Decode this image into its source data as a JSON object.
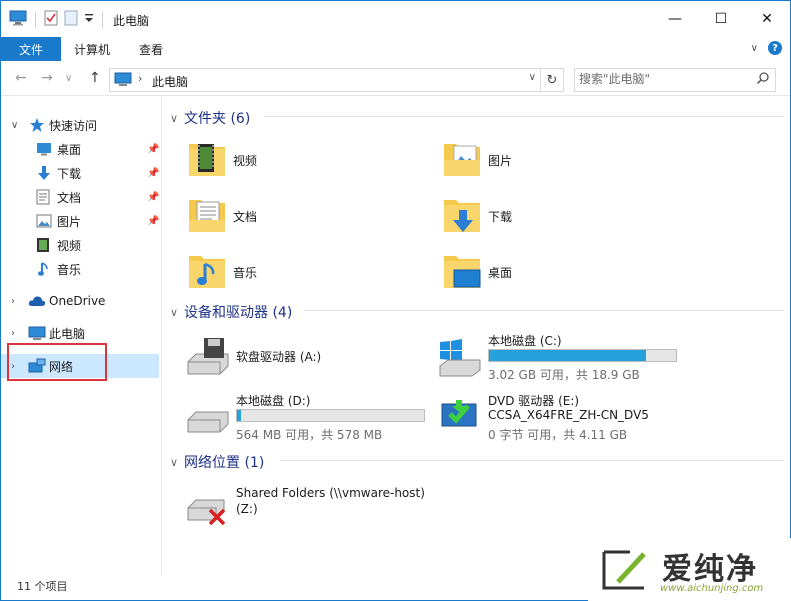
{
  "window": {
    "title": "此电脑",
    "minimize_glyph": "—",
    "maximize_glyph": "☐",
    "close_glyph": "✕"
  },
  "ribbon": {
    "file_tab": "文件",
    "tabs": [
      "计算机",
      "查看"
    ],
    "expand_glyph": "∨",
    "help_glyph": "?"
  },
  "address": {
    "crumb": "此电脑",
    "back_glyph": "←",
    "forward_glyph": "→",
    "up_glyph": "↑",
    "recent_glyph": "∨",
    "refresh_glyph": "↻",
    "search_placeholder": "搜索\"此电脑\""
  },
  "nav": {
    "quick_access": "快速访问",
    "quick_items": [
      {
        "label": "桌面",
        "icon": "desktop-icon",
        "pinned": true
      },
      {
        "label": "下载",
        "icon": "download-icon",
        "pinned": true
      },
      {
        "label": "文档",
        "icon": "document-icon",
        "pinned": true
      },
      {
        "label": "图片",
        "icon": "picture-icon",
        "pinned": true
      },
      {
        "label": "视频",
        "icon": "video-icon",
        "pinned": false
      },
      {
        "label": "音乐",
        "icon": "music-icon",
        "pinned": false
      }
    ],
    "onedrive": "OneDrive",
    "this_pc": "此电脑",
    "network": "网络"
  },
  "content": {
    "folders_header": "文件夹 (6)",
    "folders": [
      {
        "label": "视频",
        "icon": "video-folder-icon"
      },
      {
        "label": "图片",
        "icon": "picture-folder-icon"
      },
      {
        "label": "文档",
        "icon": "document-folder-icon"
      },
      {
        "label": "下载",
        "icon": "download-folder-icon"
      },
      {
        "label": "音乐",
        "icon": "music-folder-icon"
      },
      {
        "label": "桌面",
        "icon": "desktop-folder-icon"
      }
    ],
    "devices_header": "设备和驱动器 (4)",
    "floppy": {
      "name": "软盘驱动器 (A:)"
    },
    "drive_c": {
      "name": "本地磁盘 (C:)",
      "info": "3.02 GB 可用，共 18.9 GB",
      "used_fraction": 0.84
    },
    "drive_d": {
      "name": "本地磁盘 (D:)",
      "info": "564 MB 可用，共 578 MB",
      "used_fraction": 0.024
    },
    "dvd": {
      "name": "DVD 驱动器 (E:)",
      "volume": "CCSA_X64FRE_ZH-CN_DV5",
      "info": "0 字节 可用，共 4.11 GB"
    },
    "network_header": "网络位置 (1)",
    "network_share": {
      "name": "Shared Folders (\\\\vmware-host)",
      "letter": "(Z:)"
    }
  },
  "status": {
    "count": "11 个项目"
  },
  "watermark": {
    "brand": "爱纯净",
    "url": "www.aichunjing.com"
  },
  "colors": {
    "accent": "#1979ca",
    "drive_fill": "#26a0da",
    "selection": "#cce8ff",
    "highlight_box": "#d9363e",
    "group_header": "#1e3287"
  }
}
